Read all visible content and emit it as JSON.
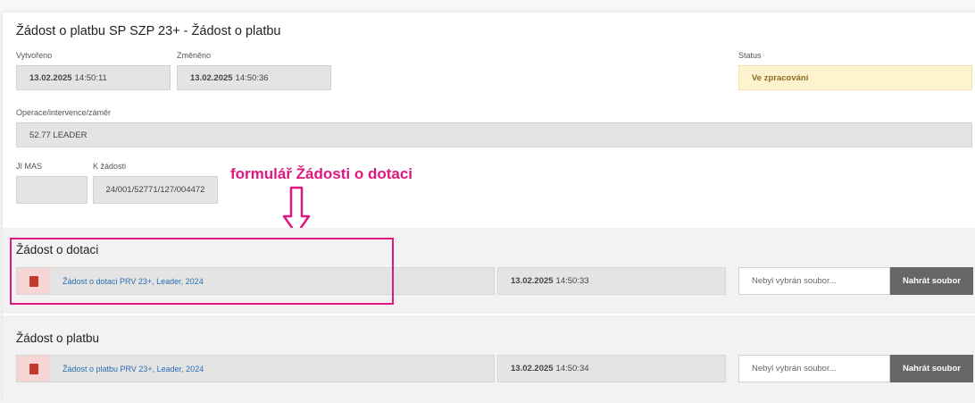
{
  "title": "Žádost o platbu SP SZP 23+ - Žádost o platbu",
  "fields": {
    "vytvoreno": {
      "label": "Vytvořeno",
      "date": "13.02.2025",
      "time": "14:50:11"
    },
    "zmeneno": {
      "label": "Změněno",
      "date": "13.02.2025",
      "time": "14:50:36"
    },
    "status": {
      "label": "Status",
      "value": "Ve zpracování"
    },
    "operace": {
      "label": "Operace/intervence/záměr",
      "value": "52.77 LEADER"
    },
    "ji_mas": {
      "label": "JI MAS",
      "value": ""
    },
    "k_zadosti": {
      "label": "K žádosti",
      "value": "24/001/52771/127/004472"
    }
  },
  "annotation": {
    "text": "formulář Žádosti o dotaci",
    "color": "#e0177e"
  },
  "sections": [
    {
      "title": "Žádost o dotaci",
      "file_label": "Žádost o dotaci PRV 23+, Leader, 2024",
      "date": "13.02.2025",
      "time": "14:50:33",
      "file_placeholder": "Nebyl vybrán soubor...",
      "upload_label": "Nahrát soubor",
      "icon": "pdf-icon"
    },
    {
      "title": "Žádost o platbu",
      "file_label": "Žádost o platbu PRV 23+, Leader, 2024",
      "date": "13.02.2025",
      "time": "14:50:34",
      "file_placeholder": "Nebyl vybrán soubor...",
      "upload_label": "Nahrát soubor",
      "icon": "pdf-icon"
    }
  ]
}
